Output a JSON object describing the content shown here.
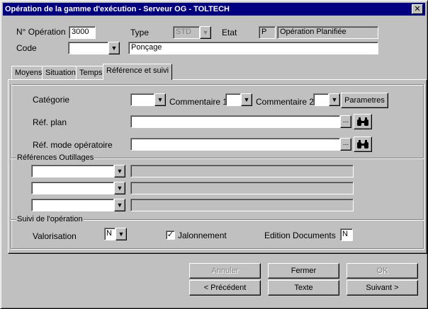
{
  "window": {
    "title": "Opération de la gamme d'exécution - Serveur OG - TOLTECH",
    "close": "✕"
  },
  "header": {
    "operation_label": "N° Opération",
    "operation_value": "3000",
    "type_label": "Type",
    "type_value": "STD",
    "etat_label": "Etat",
    "etat_code": "P",
    "etat_value": "Opération Planifiée",
    "code_label": "Code",
    "code_value": "",
    "code_desc": "Ponçage"
  },
  "tabs": [
    {
      "label": "Moyens"
    },
    {
      "label": "Situation"
    },
    {
      "label": "Temps"
    },
    {
      "label": "Référence et suivi"
    }
  ],
  "reference": {
    "categorie_label": "Catégorie",
    "commentaire1_label": "Commentaire 1",
    "commentaire2_label": "Commentaire 2",
    "parametres_button": "Parametres",
    "ref_plan_label": "Réf. plan",
    "ref_mode_label": "Réf. mode opératoire",
    "browse": "...",
    "outillages_title": "Références Outillages",
    "suivi_title": "Suivi de l'opération",
    "valorisation_label": "Valorisation",
    "valorisation_value": "N",
    "jalonnement_label": "Jalonnement",
    "jalonnement_checked": "✓",
    "edition_label": "Edition Documents",
    "edition_value": "N"
  },
  "buttons": {
    "annuler": "Annuler",
    "fermer": "Fermer",
    "ok": "OK",
    "precedent": "< Précédent",
    "texte": "Texte",
    "suivant": "Suivant >"
  },
  "icons": {
    "dropdown": "arrow-down",
    "search": "binoculars"
  }
}
